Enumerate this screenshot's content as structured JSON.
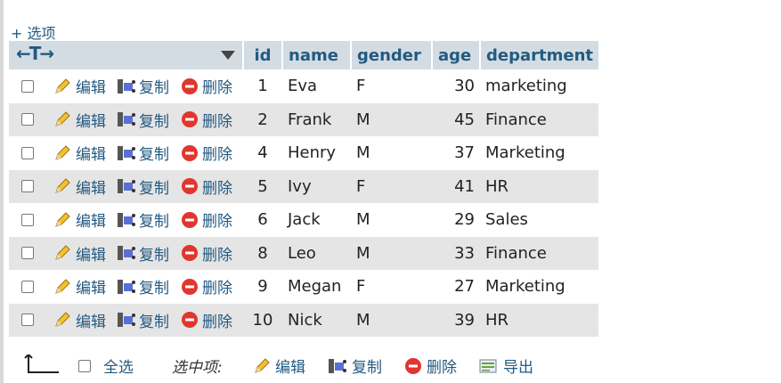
{
  "options_link": "+ 选项",
  "header": {
    "columns": [
      "id",
      "name",
      "gender",
      "age",
      "department"
    ]
  },
  "actions": {
    "edit": "编辑",
    "copy": "复制",
    "delete": "删除"
  },
  "rows": [
    {
      "id": "1",
      "name": "Eva",
      "gender": "F",
      "age": "30",
      "department": "marketing"
    },
    {
      "id": "2",
      "name": "Frank",
      "gender": "M",
      "age": "45",
      "department": "Finance"
    },
    {
      "id": "4",
      "name": "Henry",
      "gender": "M",
      "age": "37",
      "department": "Marketing"
    },
    {
      "id": "5",
      "name": "Ivy",
      "gender": "F",
      "age": "41",
      "department": "HR"
    },
    {
      "id": "6",
      "name": "Jack",
      "gender": "M",
      "age": "29",
      "department": "Sales"
    },
    {
      "id": "8",
      "name": "Leo",
      "gender": "M",
      "age": "33",
      "department": "Finance"
    },
    {
      "id": "9",
      "name": "Megan",
      "gender": "F",
      "age": "27",
      "department": "Marketing"
    },
    {
      "id": "10",
      "name": "Nick",
      "gender": "M",
      "age": "39",
      "department": "HR"
    }
  ],
  "footer": {
    "select_all": "全选",
    "with_selected": "选中项:",
    "edit": "编辑",
    "copy": "复制",
    "delete": "删除",
    "export": "导出"
  },
  "colors": {
    "link": "#235a81",
    "header_bg": "#d3dce3",
    "row_even_bg": "#e5e5e5",
    "delete_red": "#e0362e"
  }
}
